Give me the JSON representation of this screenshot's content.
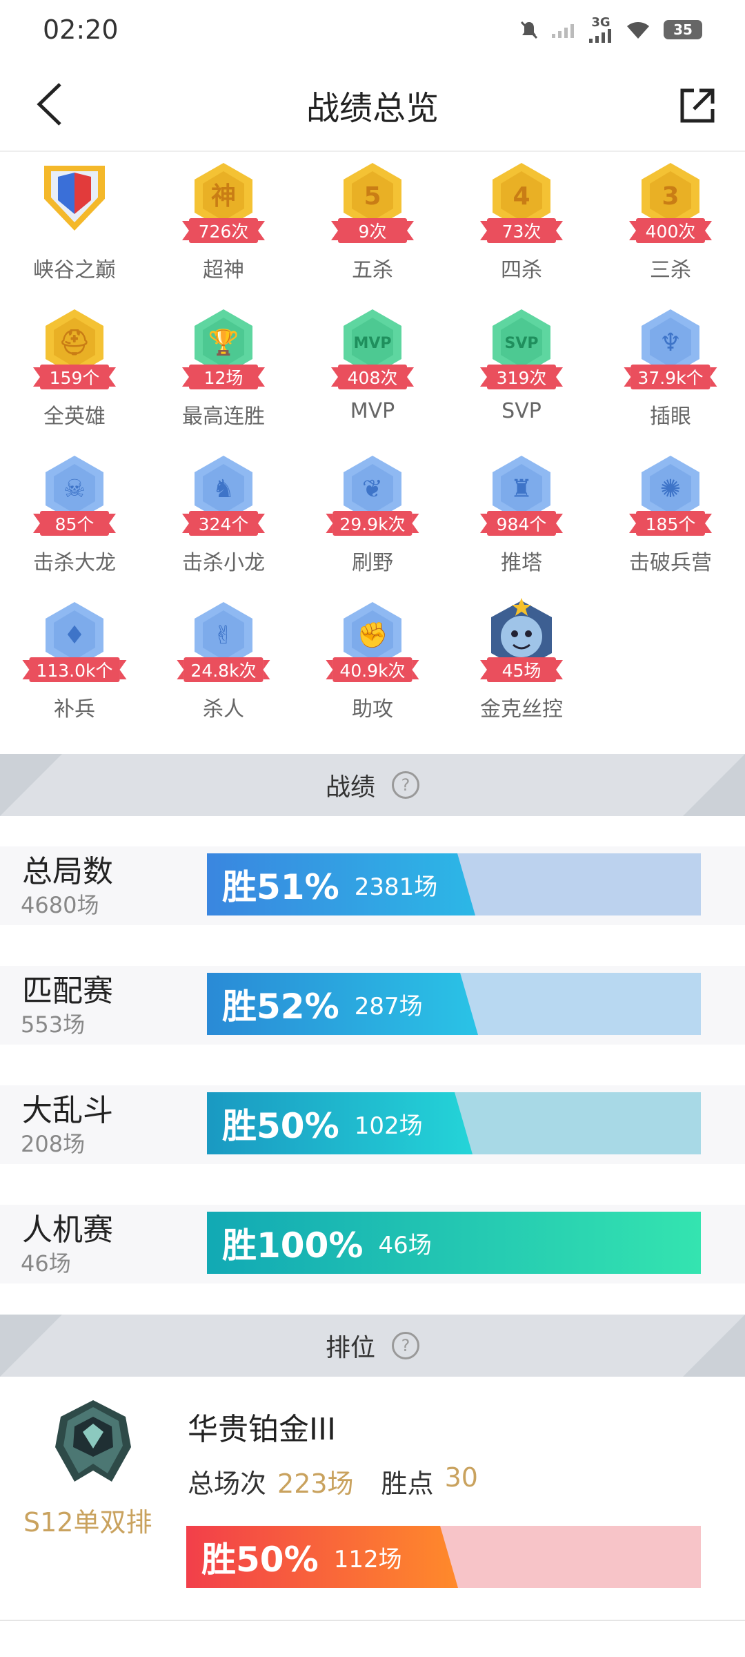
{
  "status_bar": {
    "time": "02:20",
    "network": "3G",
    "battery": "35"
  },
  "header": {
    "title": "战绩总览"
  },
  "achievements": [
    {
      "label": "峡谷之巅",
      "count": "",
      "color": "#f4c234",
      "icon": "peak-trophy-icon"
    },
    {
      "label": "超神",
      "count": "726次",
      "color": "#f4c234",
      "icon": "godlike-icon",
      "glyph": "神"
    },
    {
      "label": "五杀",
      "count": "9次",
      "color": "#f4c234",
      "icon": "penta-kill-icon",
      "glyph": "5"
    },
    {
      "label": "四杀",
      "count": "73次",
      "color": "#f4c234",
      "icon": "quadra-kill-icon",
      "glyph": "4"
    },
    {
      "label": "三杀",
      "count": "400次",
      "color": "#f4c234",
      "icon": "triple-kill-icon",
      "glyph": "3"
    },
    {
      "label": "全英雄",
      "count": "159个",
      "color": "#f4c234",
      "icon": "helmet-icon",
      "glyph": "⛑"
    },
    {
      "label": "最高连胜",
      "count": "12场",
      "color": "#5ed6a0",
      "icon": "trophy-icon",
      "glyph": "🏆"
    },
    {
      "label": "MVP",
      "count": "408次",
      "color": "#5ed6a0",
      "icon": "mvp-icon",
      "glyph": "MVP"
    },
    {
      "label": "SVP",
      "count": "319次",
      "color": "#5ed6a0",
      "icon": "svp-icon",
      "glyph": "SVP"
    },
    {
      "label": "插眼",
      "count": "37.9k个",
      "color": "#8fb9f2",
      "icon": "ward-icon",
      "glyph": "♆"
    },
    {
      "label": "击杀大龙",
      "count": "85个",
      "color": "#8fb9f2",
      "icon": "baron-icon",
      "glyph": "☠"
    },
    {
      "label": "击杀小龙",
      "count": "324个",
      "color": "#8fb9f2",
      "icon": "dragon-icon",
      "glyph": "♞"
    },
    {
      "label": "刷野",
      "count": "29.9k次",
      "color": "#8fb9f2",
      "icon": "jungle-icon",
      "glyph": "❦"
    },
    {
      "label": "推塔",
      "count": "984个",
      "color": "#8fb9f2",
      "icon": "tower-icon",
      "glyph": "♜"
    },
    {
      "label": "击破兵营",
      "count": "185个",
      "color": "#8fb9f2",
      "icon": "inhibitor-icon",
      "glyph": "✺"
    },
    {
      "label": "补兵",
      "count": "113.0k个",
      "color": "#8fb9f2",
      "icon": "minion-icon",
      "glyph": "♦"
    },
    {
      "label": "杀人",
      "count": "24.8k次",
      "color": "#8fb9f2",
      "icon": "kill-icon",
      "glyph": "✌"
    },
    {
      "label": "助攻",
      "count": "40.9k次",
      "color": "#8fb9f2",
      "icon": "assist-icon",
      "glyph": "✊"
    },
    {
      "label": "金克丝控",
      "count": "45场",
      "color": "#5a7fb8",
      "icon": "jinx-portrait-icon",
      "glyph": "☺"
    }
  ],
  "record_section": {
    "title": "战绩",
    "help": "?"
  },
  "modes": [
    {
      "name": "总局数",
      "count": "4680场",
      "win_pct": "胜51%",
      "win_games": "2381场",
      "fill": 0.51,
      "color_from": "#3a86e0",
      "color_to": "#2cb7e6",
      "bg": "#bcd2ee"
    },
    {
      "name": "匹配赛",
      "count": "553场",
      "win_pct": "胜52%",
      "win_games": "287场",
      "fill": 0.52,
      "color_from": "#2a8ad6",
      "color_to": "#2ac3e6",
      "bg": "#b8d8f1"
    },
    {
      "name": "大乱斗",
      "count": "208场",
      "win_pct": "胜50%",
      "win_games": "102场",
      "fill": 0.5,
      "color_from": "#1a99c2",
      "color_to": "#24d4d8",
      "bg": "#a8d9e6"
    },
    {
      "name": "人机赛",
      "count": "46场",
      "win_pct": "胜100%",
      "win_games": "46场",
      "fill": 1.0,
      "color_from": "#12a9b4",
      "color_to": "#34e4b0",
      "bg": "#a8e6dc"
    }
  ],
  "rank_section": {
    "title": "排位",
    "help": "?"
  },
  "ranked": {
    "season": "S12单双排",
    "tier": "华贵铂金III",
    "total_label": "总场次",
    "total_value": "223场",
    "points_label": "胜点",
    "points_value": "30",
    "win_pct": "胜50%",
    "win_games": "112场",
    "fill": 0.5,
    "color_from": "#f23f4a",
    "color_to": "#ff8a2b",
    "bg": "#f7c4c8"
  }
}
